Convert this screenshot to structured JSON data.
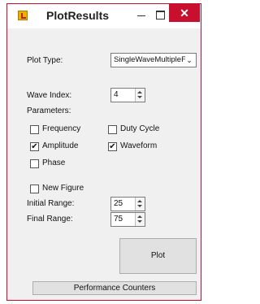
{
  "window": {
    "title": "PlotResults",
    "close_glyph": "✕"
  },
  "form": {
    "plot_type_label": "Plot Type:",
    "plot_type_value": "SingleWaveMultipleF",
    "wave_index_label": "Wave Index:",
    "wave_index_value": "4",
    "parameters_label": "Parameters:",
    "checkboxes": {
      "frequency": {
        "label": "Frequency",
        "checked": false
      },
      "duty_cycle": {
        "label": "Duty Cycle",
        "checked": false
      },
      "amplitude": {
        "label": "Amplitude",
        "checked": true
      },
      "waveform": {
        "label": "Waveform",
        "checked": true
      },
      "phase": {
        "label": "Phase",
        "checked": false
      },
      "new_figure": {
        "label": "New Figure",
        "checked": false
      }
    },
    "check_mark": "✔",
    "initial_range_label": "Initial Range:",
    "initial_range_value": "25",
    "final_range_label": "Final Range:",
    "final_range_value": "75",
    "plot_button": "Plot",
    "performance_button": "Performance Counters"
  },
  "icons": {
    "app": "plot-app-icon",
    "minimize": "minimize-icon",
    "maximize": "maximize-icon",
    "close": "close-icon",
    "dropdown": "chevron-down-icon",
    "spin": "spin-arrows-icon"
  }
}
